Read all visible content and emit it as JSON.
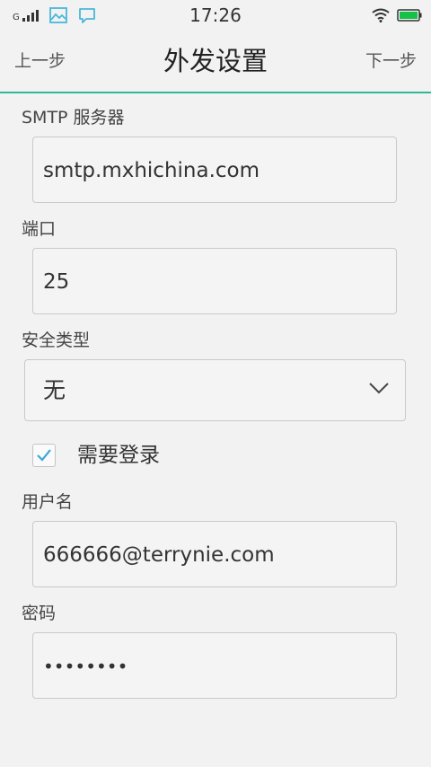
{
  "status_bar": {
    "network_type": "G",
    "time": "17:26",
    "icons": [
      "signal-icon",
      "image-notification-icon",
      "message-notification-icon",
      "wifi-icon",
      "battery-icon"
    ],
    "accent_color": "#4ab7d9",
    "battery_color": "#16c148"
  },
  "nav": {
    "back_label": "上一步",
    "title": "外发设置",
    "next_label": "下一步",
    "divider_color": "#2db89a"
  },
  "form": {
    "smtp_server": {
      "label": "SMTP 服务器",
      "value": "smtp.mxhichina.com"
    },
    "port": {
      "label": "端口",
      "value": "25"
    },
    "security_type": {
      "label": "安全类型",
      "value": "无"
    },
    "require_login": {
      "label": "需要登录",
      "checked": true
    },
    "username": {
      "label": "用户名",
      "value": "666666@terrynie.com"
    },
    "password": {
      "label": "密码",
      "value": "••••••••"
    }
  }
}
